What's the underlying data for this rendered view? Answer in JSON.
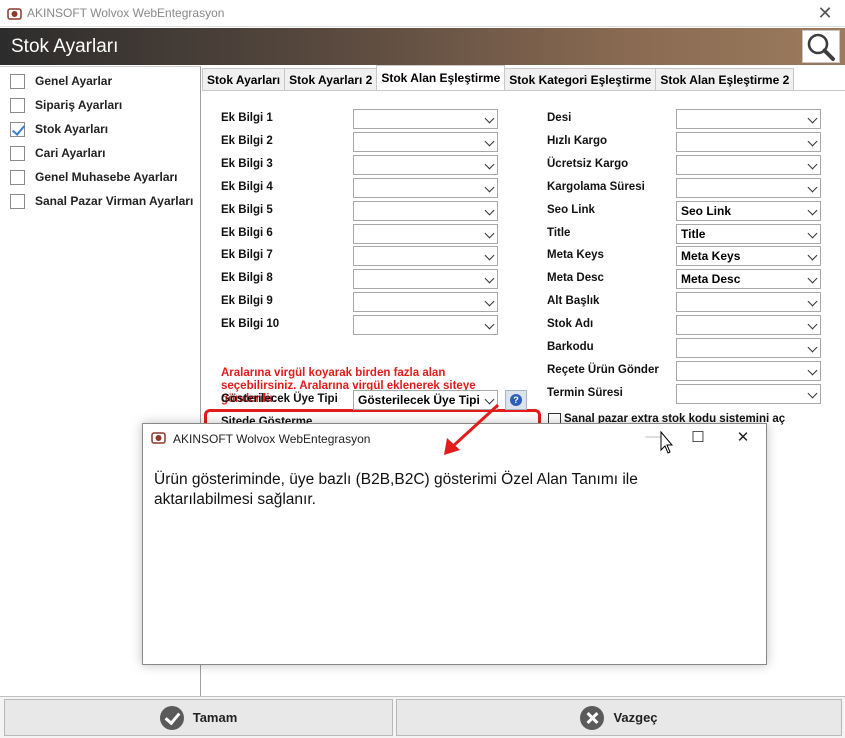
{
  "window": {
    "title": "AKINSOFT Wolvox WebEntegrasyon",
    "close": "✕"
  },
  "header": {
    "title": "Stok Ayarları"
  },
  "sidebar": {
    "items": [
      {
        "label": "Genel Ayarlar",
        "checked": false
      },
      {
        "label": "Sipariş Ayarları",
        "checked": false
      },
      {
        "label": "Stok Ayarları",
        "checked": true
      },
      {
        "label": "Cari Ayarları",
        "checked": false
      },
      {
        "label": "Genel Muhasebe Ayarları",
        "checked": false
      },
      {
        "label": "Sanal Pazar Virman Ayarları",
        "checked": false
      }
    ]
  },
  "tabs": [
    {
      "label": "Stok Ayarları",
      "active": false
    },
    {
      "label": "Stok Ayarları 2",
      "active": false
    },
    {
      "label": "Stok Alan Eşleştirme",
      "active": true
    },
    {
      "label": "Stok Kategori Eşleştirme",
      "active": false
    },
    {
      "label": "Stok Alan Eşleştirme 2",
      "active": false
    }
  ],
  "left_fields": [
    {
      "label": "Ek Bilgi 1",
      "value": ""
    },
    {
      "label": "Ek Bilgi 2",
      "value": ""
    },
    {
      "label": "Ek Bilgi 3",
      "value": ""
    },
    {
      "label": "Ek Bilgi 4",
      "value": ""
    },
    {
      "label": "Ek Bilgi 5",
      "value": ""
    },
    {
      "label": "Ek Bilgi 6",
      "value": ""
    },
    {
      "label": "Ek Bilgi 7",
      "value": ""
    },
    {
      "label": "Ek Bilgi 8",
      "value": ""
    },
    {
      "label": "Ek Bilgi 9",
      "value": ""
    },
    {
      "label": "Ek Bilgi 10",
      "value": ""
    }
  ],
  "right_fields": [
    {
      "label": "Desi",
      "value": ""
    },
    {
      "label": "Hızlı Kargo",
      "value": ""
    },
    {
      "label": "Ücretsiz Kargo",
      "value": ""
    },
    {
      "label": "Kargolama Süresi",
      "value": ""
    },
    {
      "label": "Seo Link",
      "value": "Seo Link"
    },
    {
      "label": "Title",
      "value": "Title"
    },
    {
      "label": "Meta Keys",
      "value": "Meta Keys"
    },
    {
      "label": "Meta Desc",
      "value": "Meta Desc"
    },
    {
      "label": "Alt Başlık",
      "value": ""
    },
    {
      "label": "Stok Adı",
      "value": ""
    },
    {
      "label": "Barkodu",
      "value": ""
    },
    {
      "label": "Reçete Ürün Gönder",
      "value": ""
    },
    {
      "label": "Termin Süresi",
      "value": ""
    }
  ],
  "note": "Aralarına virgül koyarak birden fazla alan seçebilirsiniz. Aralarına virgül  eklenerek siteye gönderilir.",
  "member_type": {
    "label": "Gösterilecek Üye Tipi",
    "value": "Gösterilecek Üye Tipi"
  },
  "partial_label": "Sitede Gösterme",
  "checkbox_label": "Sanal pazar extra stok kodu sistemini aç",
  "buttons": {
    "ok": "Tamam",
    "cancel": "Vazgeç"
  },
  "dialog": {
    "title": "AKINSOFT Wolvox WebEntegrasyon",
    "message": "Ürün gösteriminde, üye bazlı (B2B,B2C) gösterimi Özel Alan Tanımı ile aktarılabilmesi sağlanır.",
    "minimize": "—",
    "maximize": "☐",
    "close": "✕"
  },
  "colors": {
    "highlight": "#e31b1b",
    "note": "#e01b1b"
  }
}
